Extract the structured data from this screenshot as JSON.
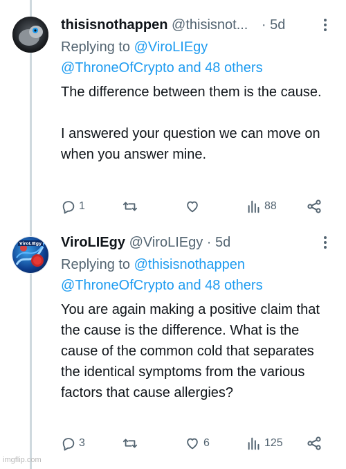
{
  "tweets": [
    {
      "name": "thisisnothappen",
      "handle": "@thisisnot...",
      "separator": "·",
      "time": "5d",
      "replying_prefix": "Replying to",
      "replying_to": "@ViroLIEgy",
      "replying_others": "@ThroneOfCrypto and 48 others",
      "text": "The difference between them is the cause.\n\nI answered your question we can move on when you answer mine.",
      "replies": "1",
      "retweets": "",
      "likes": "",
      "views": "88"
    },
    {
      "name": "ViroLIEgy",
      "handle": "@ViroLIEgy",
      "separator": "·",
      "time": "5d",
      "replying_prefix": "Replying to",
      "replying_to": "@thisisnothappen",
      "replying_others": "@ThroneOfCrypto and 48 others",
      "text": "You are again making a positive claim that the cause is the difference. What is the cause of the common cold that separates the identical symptoms from the various factors that cause allergies?",
      "replies": "3",
      "retweets": "",
      "likes": "6",
      "views": "125"
    }
  ],
  "avatar2_label": "ViroLIEgy",
  "watermark": "imgflip.com",
  "colors": {
    "link": "#1d9bf0",
    "muted": "#536471",
    "text": "#0f1419",
    "thread": "#cfd9de"
  }
}
